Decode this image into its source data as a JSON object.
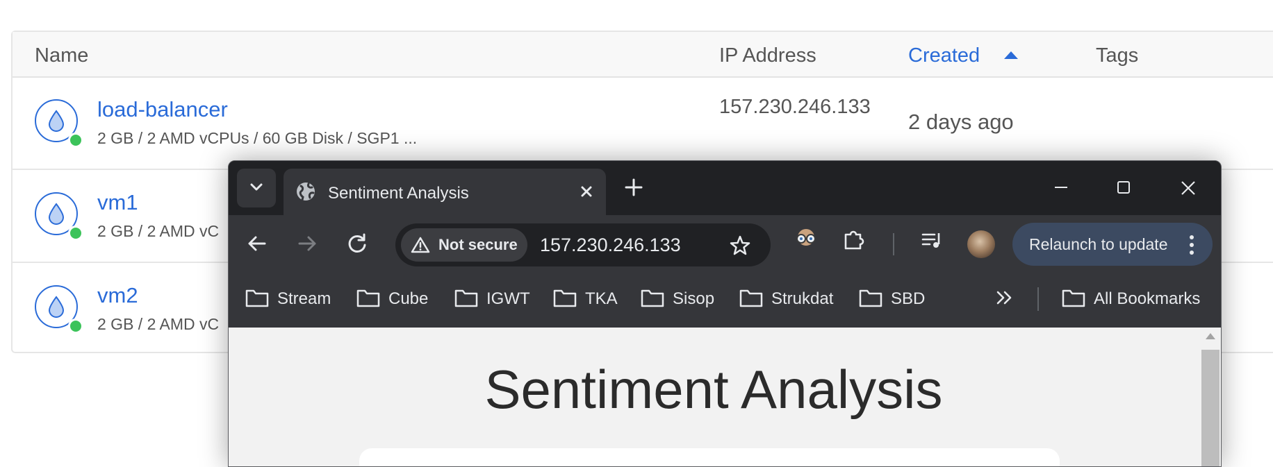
{
  "table": {
    "columns": {
      "name": "Name",
      "ip": "IP Address",
      "created": "Created",
      "tags": "Tags"
    },
    "rows": [
      {
        "name": "load-balancer",
        "spec": "2 GB / 2 AMD vCPUs / 60 GB Disk / SGP1 ...",
        "ip": "157.230.246.133",
        "created": "2 days ago"
      },
      {
        "name": "vm1",
        "spec": "2 GB / 2 AMD vC"
      },
      {
        "name": "vm2",
        "spec": "2 GB / 2 AMD vC"
      }
    ]
  },
  "browser": {
    "tab_title": "Sentiment Analysis",
    "security_label": "Not secure",
    "url": "157.230.246.133",
    "relaunch_label": "Relaunch to update",
    "bookmarks": [
      "Stream",
      "Cube",
      "IGWT",
      "TKA",
      "Sisop",
      "Strukdat",
      "SBD"
    ],
    "all_bookmarks": "All Bookmarks",
    "page_heading": "Sentiment Analysis"
  },
  "colors": {
    "accent": "#2a6bd8",
    "status_online": "#3cc35a",
    "browser_dark": "#202124"
  }
}
